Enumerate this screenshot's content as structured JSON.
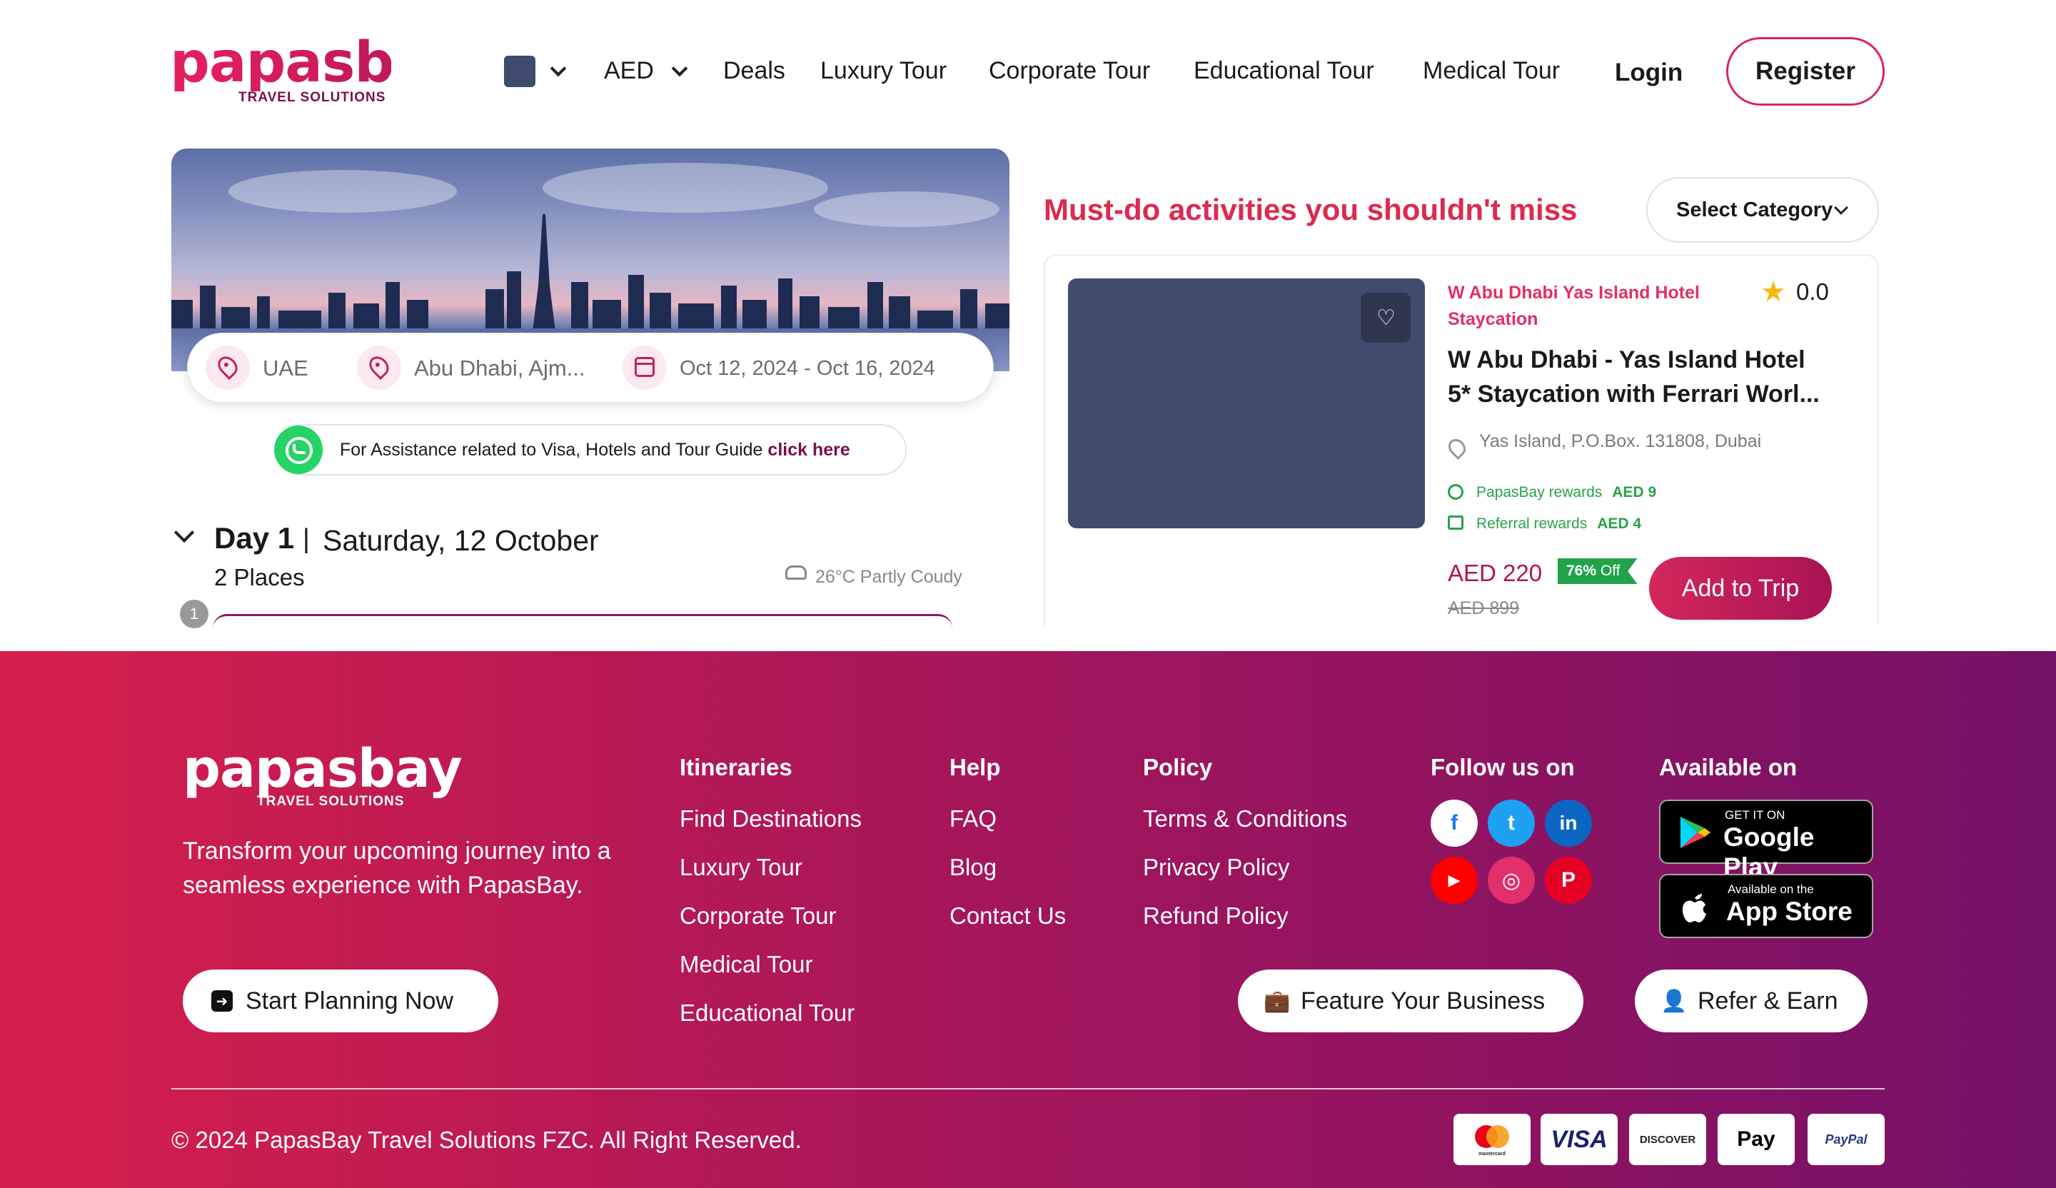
{
  "header": {
    "logo_text": "papasbay",
    "logo_tagline": "TRAVEL SOLUTIONS",
    "currency": "AED",
    "nav": [
      "Deals",
      "Luxury Tour",
      "Corporate Tour",
      "Educational Tour",
      "Medical Tour"
    ],
    "login": "Login",
    "register": "Register"
  },
  "trip": {
    "country": "UAE",
    "cities": "Abu Dhabi, Ajm...",
    "dates": "Oct 12, 2024 - Oct 16, 2024",
    "assist_text": "For Assistance related to Visa, Hotels and Tour Guide",
    "assist_link": "click here",
    "day_label": "Day 1",
    "separator": "|",
    "day_date": "Saturday, 12 October",
    "places": "2 Places",
    "weather": "26°C Partly Coudy",
    "stop_number": "1"
  },
  "activities": {
    "title": "Must-do activities you shouldn't miss",
    "category_select": "Select Category",
    "card": {
      "subtitle": "W Abu Dhabi Yas Island Hotel Staycation",
      "rating": "0.0",
      "title": "W Abu Dhabi - Yas Island Hotel 5* Staycation with Ferrari Worl...",
      "location": "Yas Island, P.O.Box. 131808, Dubai",
      "papasbay_rewards_label": "PapasBay rewards",
      "papasbay_rewards_amount": "AED 9",
      "referral_rewards_label": "Referral rewards",
      "referral_rewards_amount": "AED 4",
      "price": "AED 220",
      "discount_percent": "76%",
      "discount_word": "Off",
      "old_price": "AED 899",
      "add_button": "Add to Trip"
    }
  },
  "footer": {
    "logo_text": "papasbay",
    "logo_tagline": "TRAVEL SOLUTIONS",
    "description": "Transform your upcoming journey into a seamless experience with PapasBay.",
    "start_planning": "Start Planning Now",
    "itineraries_heading": "Itineraries",
    "itineraries": [
      "Find Destinations",
      "Luxury Tour",
      "Corporate Tour",
      "Medical Tour",
      "Educational Tour"
    ],
    "help_heading": "Help",
    "help": [
      "FAQ",
      "Blog",
      "Contact Us"
    ],
    "policy_heading": "Policy",
    "policy": [
      "Terms & Conditions",
      "Privacy Policy",
      "Refund Policy"
    ],
    "follow_heading": "Follow us on",
    "social": [
      "facebook-icon",
      "twitter-icon",
      "linkedin-icon",
      "youtube-icon",
      "instagram-icon",
      "pinterest-icon"
    ],
    "available_heading": "Available on",
    "google_play_small": "GET IT ON",
    "google_play_big": "Google Play",
    "app_store_small": "Available on the",
    "app_store_big": "App Store",
    "feature_business": "Feature Your Business",
    "refer_earn": "Refer & Earn",
    "copyright": "© 2024 PapasBay Travel Solutions FZC. All Right Reserved.",
    "payments": [
      "mastercard",
      "VISA",
      "DISCOVER",
      "Pay",
      "PayPal"
    ]
  },
  "colors": {
    "brand_pink": "#d8265f",
    "brand_purple": "#751168",
    "reward_green": "#2aa14a",
    "activity_title": "#dd2a4f"
  }
}
